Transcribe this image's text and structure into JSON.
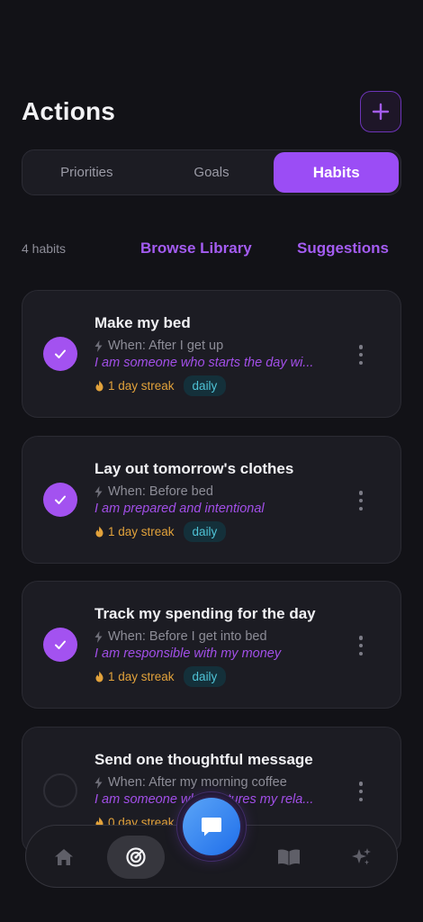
{
  "header": {
    "title": "Actions",
    "add_icon": "plus-icon"
  },
  "tabs": [
    {
      "label": "Priorities",
      "active": false
    },
    {
      "label": "Goals",
      "active": false
    },
    {
      "label": "Habits",
      "active": true
    }
  ],
  "habits_meta": {
    "count": "4 habits",
    "browse": "Browse Library",
    "suggestions": "Suggestions"
  },
  "habits": [
    {
      "title": "Make my bed",
      "when": "When: After I get up",
      "identity": "I am someone who starts the day wi...",
      "streak": "1 day streak",
      "frequency": "daily",
      "done": true
    },
    {
      "title": "Lay out tomorrow's clothes",
      "when": "When: Before bed",
      "identity": "I am prepared and intentional",
      "streak": "1 day streak",
      "frequency": "daily",
      "done": true
    },
    {
      "title": "Track my spending for the day",
      "when": "When: Before I get into bed",
      "identity": "I am responsible with my money",
      "streak": "1 day streak",
      "frequency": "daily",
      "done": true
    },
    {
      "title": "Send one thoughtful message",
      "when": "When: After my morning coffee",
      "identity": "I am someone who nurtures my rela...",
      "streak": "0 day streak",
      "frequency": "daily",
      "done": false
    }
  ],
  "nav": {
    "items": [
      "home-icon",
      "actions-icon",
      "chat-icon",
      "library-icon",
      "coach-icon"
    ],
    "active": "actions-icon"
  },
  "colors": {
    "accent": "#9B4DF5",
    "background": "#121217",
    "card": "#1C1C23",
    "streak": "#E2A23B",
    "daily": "#4FC3D6"
  }
}
